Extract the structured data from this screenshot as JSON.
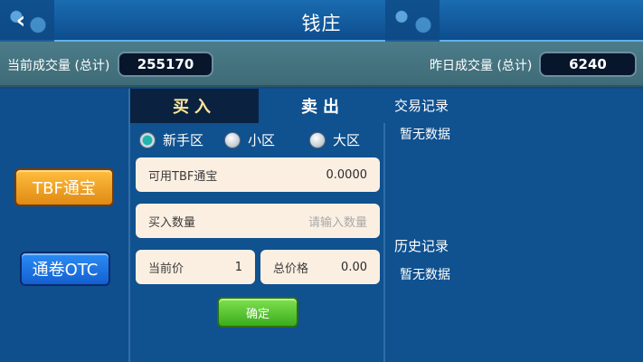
{
  "header": {
    "title": "钱庄",
    "back_glyph": "‹"
  },
  "stats": {
    "current_label": "当前成交量 (总计)",
    "current_value": "255170",
    "yesterday_label": "昨日成交量 (总计)",
    "yesterday_value": "6240"
  },
  "left": {
    "tbf_button": "TBF通宝",
    "otc_button": "通卷OTC"
  },
  "tabs": {
    "buy": "买入",
    "sell": "卖出"
  },
  "zones": [
    {
      "label": "新手区",
      "selected": true
    },
    {
      "label": "小区",
      "selected": false
    },
    {
      "label": "大区",
      "selected": false
    }
  ],
  "form": {
    "available_label": "可用TBF通宝",
    "available_value": "0.0000",
    "quantity_label": "买入数量",
    "quantity_placeholder": "请输入数量",
    "price_label": "当前价",
    "price_value": "1",
    "total_label": "总价格",
    "total_value": "0.00",
    "confirm": "确定"
  },
  "records": {
    "trade_title": "交易记录",
    "trade_empty": "暂无数据",
    "history_title": "历史记录",
    "history_empty": "暂无数据"
  },
  "colors": {
    "background": "#0f4a86",
    "tbf_orange": "#f0a028",
    "otc_blue": "#1f78e6",
    "confirm_green": "#52c22e"
  }
}
